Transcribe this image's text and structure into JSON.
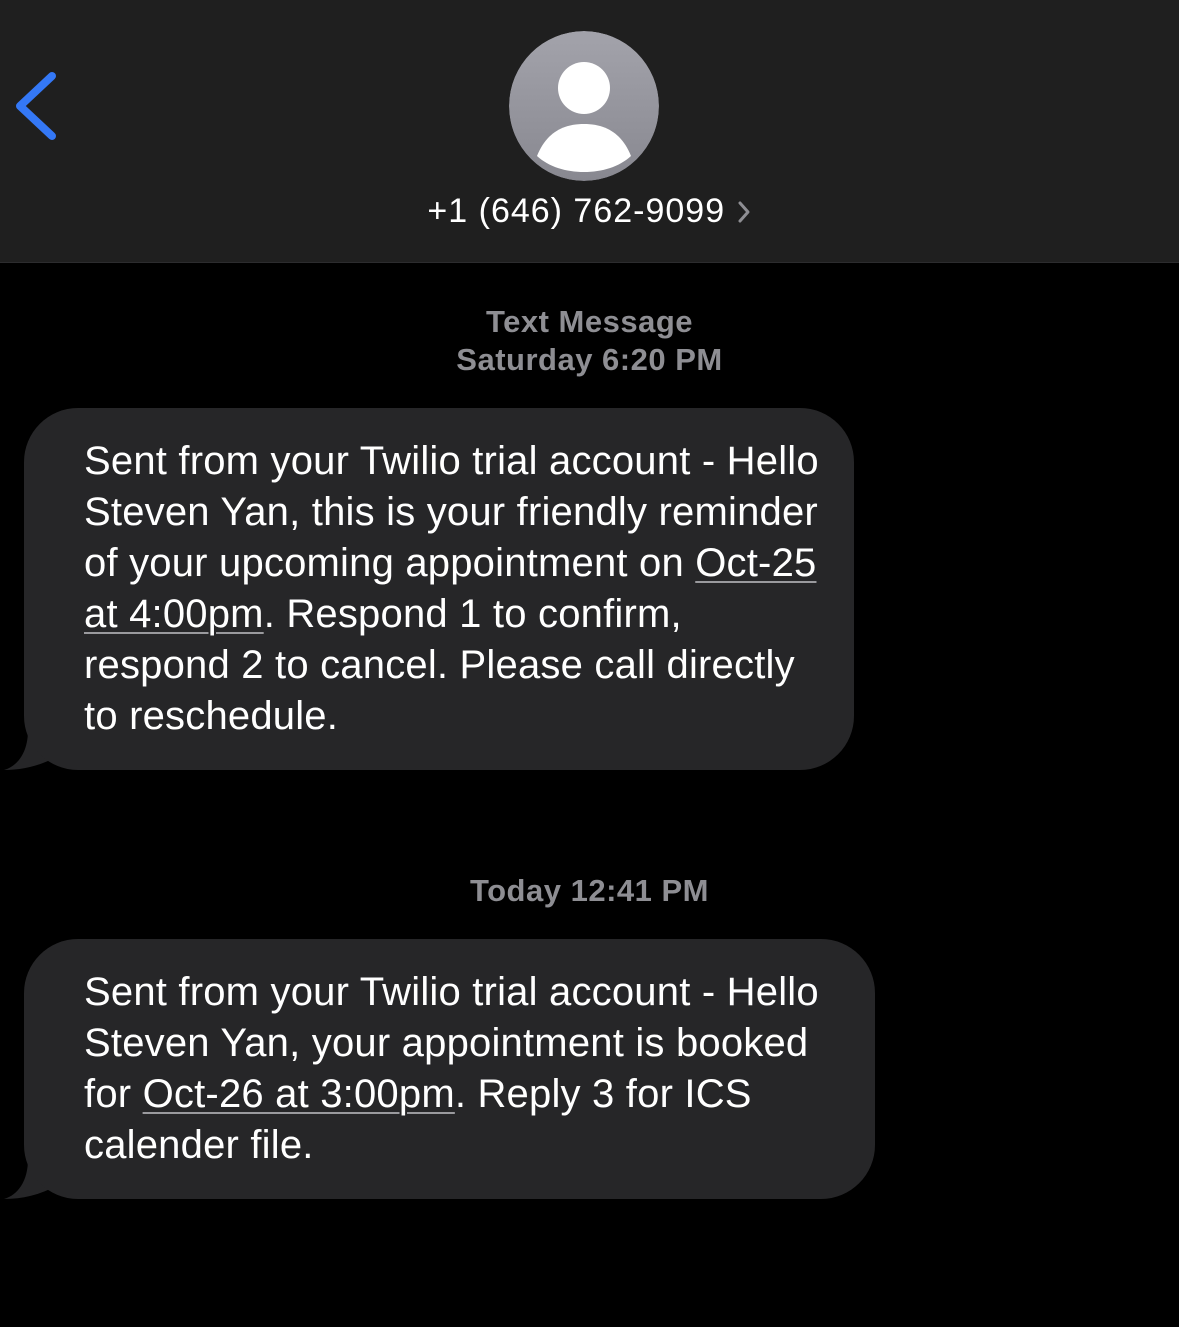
{
  "header": {
    "back_icon": "chevron-left-icon",
    "avatar_icon": "person-icon",
    "contact_number": "+1 (646) 762-9099",
    "contact_chevron_icon": "chevron-right-icon"
  },
  "thread": {
    "label_1": "Text Message",
    "timestamp_1": "Saturday 6:20 PM",
    "message_1": {
      "text_before_link": "Sent from your Twilio trial account - Hello Steven Yan, this is your friendly reminder of your upcoming appointment on ",
      "link": "Oct-25 at 4:00pm",
      "text_after_link": ". Respond 1 to confirm, respond 2 to cancel. Please call directly to reschedule."
    },
    "timestamp_2": "Today 12:41 PM",
    "message_2": {
      "text_before_link": "Sent from your Twilio trial account - Hello Steven Yan, your appointment is booked for ",
      "link": "Oct-26 at 3:00pm",
      "text_after_link": ". Reply 3 for ICS calender file."
    }
  },
  "colors": {
    "background": "#000000",
    "header_background": "#1f1f1f",
    "accent_blue": "#3478f6",
    "bubble_gray": "#262628",
    "timestamp_gray": "#8e8e93",
    "avatar_gray": "#9c9ca4"
  }
}
